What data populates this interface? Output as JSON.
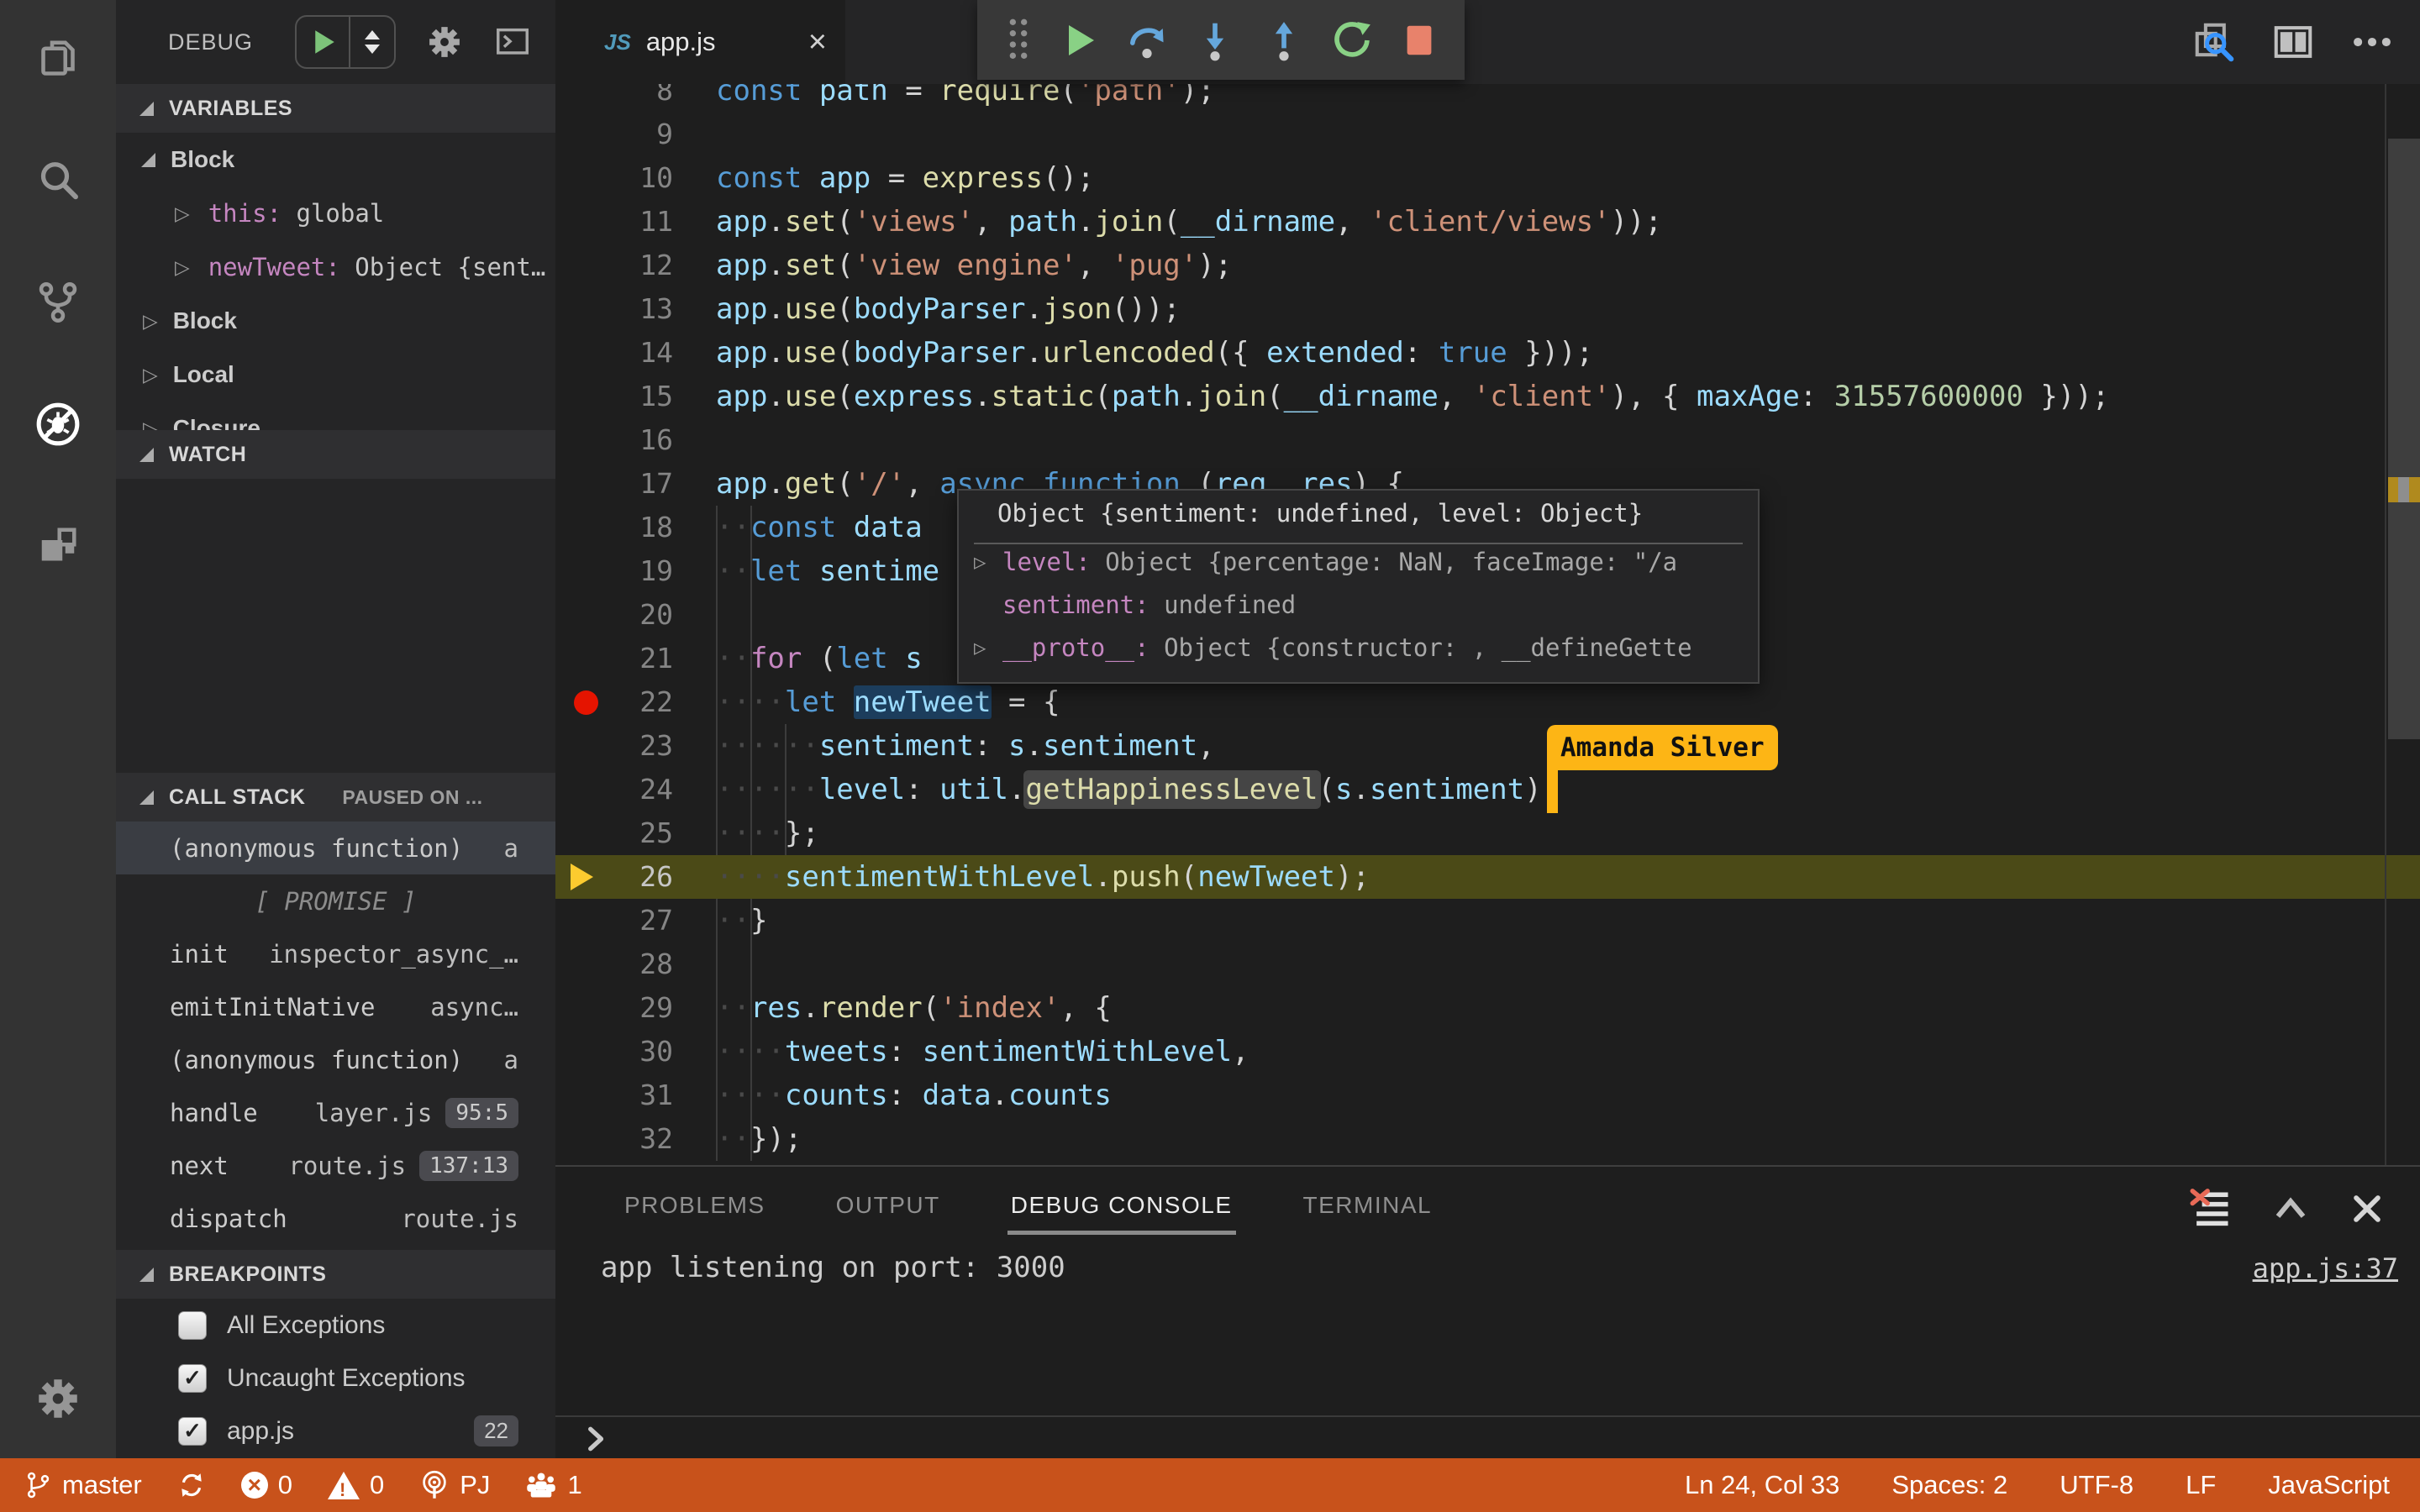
{
  "colors": {
    "status_bar": "#C8521B",
    "amanda_tag": "#FDB515",
    "breakpoint_red": "#E51400",
    "current_line_arrow": "#FCCB2F",
    "current_line_bg": "#4B4A17",
    "tab_js_icon": "#519ABA",
    "accent_blue": "#569CD6"
  },
  "activity_bar": {
    "items": [
      {
        "icon": "files-icon",
        "active": false
      },
      {
        "icon": "search-icon",
        "active": false
      },
      {
        "icon": "source-control-icon",
        "active": false
      },
      {
        "icon": "debug-icon",
        "active": true
      },
      {
        "icon": "extensions-icon",
        "active": false
      }
    ],
    "settings_icon": "gear-icon"
  },
  "sidebar": {
    "header": {
      "title": "DEBUG",
      "controls": [
        "start-debug-button",
        "launch-config-selector",
        "configure-gear",
        "debug-console-toggle"
      ]
    },
    "variables": {
      "title": "VARIABLES",
      "rows": [
        {
          "type": "group",
          "label": "Block",
          "expanded": true
        },
        {
          "type": "item",
          "key": "this:",
          "value": " global"
        },
        {
          "type": "item",
          "key": "newTweet:",
          "value": " Object {sent…"
        },
        {
          "type": "group",
          "label": "Block",
          "expanded": false
        },
        {
          "type": "group",
          "label": "Local",
          "expanded": false
        },
        {
          "type": "group",
          "label": "Closure",
          "expanded": false
        }
      ]
    },
    "watch": {
      "title": "WATCH"
    },
    "call_stack": {
      "title": "CALL STACK",
      "status": "PAUSED ON ...",
      "frames": [
        {
          "name": "(anonymous function)",
          "file": "a",
          "selected": true
        },
        {
          "label": "[ PROMISE ]",
          "promise": true
        },
        {
          "name": "init",
          "file": "inspector_async_…"
        },
        {
          "name": "emitInitNative",
          "file": "async…"
        },
        {
          "name": "(anonymous function)",
          "file": "a"
        },
        {
          "name": "handle",
          "file": "layer.js",
          "badge": "95:5"
        },
        {
          "name": "next",
          "file": "route.js",
          "badge": "137:13"
        },
        {
          "name": "dispatch",
          "file": "route.js"
        }
      ]
    },
    "breakpoints": {
      "title": "BREAKPOINTS",
      "rows": [
        {
          "label": "All Exceptions",
          "checked": false
        },
        {
          "label": "Uncaught Exceptions",
          "checked": true
        },
        {
          "label": "app.js",
          "checked": true,
          "badge": "22"
        }
      ]
    }
  },
  "editor": {
    "tab": {
      "icon_label": "JS",
      "title": "app.js",
      "close": "×"
    },
    "toolbar": {
      "icons": [
        "drag-grip",
        "continue",
        "step-over",
        "step-into",
        "step-out",
        "restart",
        "stop"
      ]
    },
    "actions": [
      "find-references-icon",
      "split-editor-icon",
      "more-actions-icon"
    ],
    "lines": [
      {
        "n": 8,
        "t": [
          [
            "k",
            "const "
          ],
          [
            "v",
            "path"
          ],
          [
            "p",
            " = "
          ],
          [
            "f",
            "require"
          ],
          [
            "p",
            "("
          ],
          [
            "s",
            "'path'"
          ],
          [
            "p",
            ");"
          ]
        ]
      },
      {
        "n": 9,
        "t": []
      },
      {
        "n": 10,
        "t": [
          [
            "k",
            "const "
          ],
          [
            "v",
            "app"
          ],
          [
            "p",
            " = "
          ],
          [
            "f",
            "express"
          ],
          [
            "p",
            "();"
          ]
        ]
      },
      {
        "n": 11,
        "t": [
          [
            "v",
            "app"
          ],
          [
            "p",
            "."
          ],
          [
            "f",
            "set"
          ],
          [
            "p",
            "("
          ],
          [
            "s",
            "'views'"
          ],
          [
            "p",
            ", "
          ],
          [
            "v",
            "path"
          ],
          [
            "p",
            "."
          ],
          [
            "f",
            "join"
          ],
          [
            "p",
            "("
          ],
          [
            "v",
            "__dirname"
          ],
          [
            "p",
            ", "
          ],
          [
            "s",
            "'client/views'"
          ],
          [
            "p",
            "));"
          ]
        ]
      },
      {
        "n": 12,
        "t": [
          [
            "v",
            "app"
          ],
          [
            "p",
            "."
          ],
          [
            "f",
            "set"
          ],
          [
            "p",
            "("
          ],
          [
            "s",
            "'view engine'"
          ],
          [
            "p",
            ", "
          ],
          [
            "s",
            "'pug'"
          ],
          [
            "p",
            ");"
          ]
        ]
      },
      {
        "n": 13,
        "t": [
          [
            "v",
            "app"
          ],
          [
            "p",
            "."
          ],
          [
            "f",
            "use"
          ],
          [
            "p",
            "("
          ],
          [
            "v",
            "bodyParser"
          ],
          [
            "p",
            "."
          ],
          [
            "f",
            "json"
          ],
          [
            "p",
            "());"
          ]
        ]
      },
      {
        "n": 14,
        "t": [
          [
            "v",
            "app"
          ],
          [
            "p",
            "."
          ],
          [
            "f",
            "use"
          ],
          [
            "p",
            "("
          ],
          [
            "v",
            "bodyParser"
          ],
          [
            "p",
            "."
          ],
          [
            "f",
            "urlencoded"
          ],
          [
            "p",
            "({ "
          ],
          [
            "v",
            "extended"
          ],
          [
            "p",
            ": "
          ],
          [
            "k",
            "true"
          ],
          [
            "p",
            " }));"
          ]
        ]
      },
      {
        "n": 15,
        "t": [
          [
            "v",
            "app"
          ],
          [
            "p",
            "."
          ],
          [
            "f",
            "use"
          ],
          [
            "p",
            "("
          ],
          [
            "v",
            "express"
          ],
          [
            "p",
            "."
          ],
          [
            "f",
            "static"
          ],
          [
            "p",
            "("
          ],
          [
            "v",
            "path"
          ],
          [
            "p",
            "."
          ],
          [
            "f",
            "join"
          ],
          [
            "p",
            "("
          ],
          [
            "v",
            "__dirname"
          ],
          [
            "p",
            ", "
          ],
          [
            "s",
            "'client'"
          ],
          [
            "p",
            "), { "
          ],
          [
            "v",
            "maxAge"
          ],
          [
            "p",
            ": "
          ],
          [
            "n",
            "31557600000"
          ],
          [
            "p",
            " }));"
          ]
        ]
      },
      {
        "n": 16,
        "t": []
      },
      {
        "n": 17,
        "t": [
          [
            "v",
            "app"
          ],
          [
            "p",
            "."
          ],
          [
            "f",
            "get"
          ],
          [
            "p",
            "("
          ],
          [
            "s",
            "'/'"
          ],
          [
            "p",
            ", "
          ],
          [
            "k",
            "async"
          ],
          [
            "p",
            " "
          ],
          [
            "k",
            "function"
          ],
          [
            "p",
            " ("
          ],
          [
            "v",
            "req"
          ],
          [
            "p",
            ", "
          ],
          [
            "v",
            "res"
          ],
          [
            "p",
            ") {"
          ]
        ]
      },
      {
        "n": 18,
        "t": [
          [
            "w",
            "··"
          ],
          [
            "k",
            "const "
          ],
          [
            "v",
            "data"
          ]
        ]
      },
      {
        "n": 19,
        "t": [
          [
            "w",
            "··"
          ],
          [
            "k",
            "let "
          ],
          [
            "v",
            "sentime"
          ]
        ]
      },
      {
        "n": 20,
        "t": []
      },
      {
        "n": 21,
        "t": [
          [
            "w",
            "··"
          ],
          [
            "c",
            "for"
          ],
          [
            "p",
            " ("
          ],
          [
            "k",
            "let "
          ],
          [
            "v",
            "s"
          ]
        ]
      },
      {
        "n": 22,
        "bp": true,
        "t": [
          [
            "w",
            "····"
          ],
          [
            "k",
            "let "
          ],
          [
            "v",
            "newTweet",
            "sel"
          ],
          [
            "p",
            " = {"
          ]
        ]
      },
      {
        "n": 23,
        "t": [
          [
            "w",
            "······"
          ],
          [
            "v",
            "sentiment"
          ],
          [
            "p",
            ": "
          ],
          [
            "v",
            "s"
          ],
          [
            "p",
            "."
          ],
          [
            "v",
            "sentiment"
          ],
          [
            "p",
            ","
          ]
        ]
      },
      {
        "n": 24,
        "t": [
          [
            "w",
            "······"
          ],
          [
            "v",
            "level"
          ],
          [
            "p",
            ": "
          ],
          [
            "v",
            "util"
          ],
          [
            "p",
            "."
          ],
          [
            "f",
            "getHappinessLevel",
            "hl"
          ],
          [
            "p",
            "("
          ],
          [
            "v",
            "s"
          ],
          [
            "p",
            "."
          ],
          [
            "v",
            "sentiment"
          ],
          [
            "p",
            ")"
          ]
        ]
      },
      {
        "n": 25,
        "t": [
          [
            "w",
            "····"
          ],
          [
            "p",
            "};"
          ]
        ]
      },
      {
        "n": 26,
        "cur": true,
        "t": [
          [
            "w",
            "····"
          ],
          [
            "v",
            "sentimentWithLevel"
          ],
          [
            "p",
            "."
          ],
          [
            "f",
            "push"
          ],
          [
            "p",
            "("
          ],
          [
            "v",
            "newTweet"
          ],
          [
            "p",
            ");"
          ]
        ]
      },
      {
        "n": 27,
        "t": [
          [
            "w",
            "··"
          ],
          [
            "p",
            "}"
          ]
        ]
      },
      {
        "n": 28,
        "t": []
      },
      {
        "n": 29,
        "t": [
          [
            "w",
            "··"
          ],
          [
            "v",
            "res"
          ],
          [
            "p",
            "."
          ],
          [
            "f",
            "render"
          ],
          [
            "p",
            "("
          ],
          [
            "s",
            "'index'"
          ],
          [
            "p",
            ", {"
          ]
        ]
      },
      {
        "n": 30,
        "t": [
          [
            "w",
            "····"
          ],
          [
            "v",
            "tweets"
          ],
          [
            "p",
            ": "
          ],
          [
            "v",
            "sentimentWithLevel"
          ],
          [
            "p",
            ","
          ]
        ]
      },
      {
        "n": 31,
        "t": [
          [
            "w",
            "····"
          ],
          [
            "v",
            "counts"
          ],
          [
            "p",
            ": "
          ],
          [
            "v",
            "data"
          ],
          [
            "p",
            "."
          ],
          [
            "v",
            "counts"
          ]
        ]
      },
      {
        "n": 32,
        "t": [
          [
            "w",
            "··"
          ],
          [
            "p",
            "});"
          ]
        ]
      }
    ],
    "popup": {
      "title": "Object {sentiment: undefined, level: Object}",
      "rows": [
        {
          "arrow": true,
          "key": "level:",
          "value": " Object {percentage: NaN, faceImage: \"/a"
        },
        {
          "arrow": false,
          "key": "sentiment:",
          "value": " undefined"
        },
        {
          "arrow": true,
          "key": "__proto__:",
          "value": " Object {constructor: , __defineGette"
        }
      ]
    },
    "amanda": {
      "label": "Amanda Silver"
    }
  },
  "panel": {
    "tabs": [
      "PROBLEMS",
      "OUTPUT",
      "DEBUG CONSOLE",
      "TERMINAL"
    ],
    "active_tab": "DEBUG CONSOLE",
    "actions": [
      "clear-console-icon",
      "maximize-panel-icon",
      "close-panel-icon"
    ],
    "console_line": "app listening on port: 3000",
    "link": "app.js:37"
  },
  "status_bar": {
    "left": [
      {
        "icon": "git-branch-icon",
        "label": "master"
      },
      {
        "icon": "sync-icon",
        "label": ""
      },
      {
        "icon": "error-circle-icon",
        "label": "0"
      },
      {
        "icon": "warning-triangle-icon",
        "label": "0"
      },
      {
        "icon": "broadcast-icon",
        "label": "PJ"
      },
      {
        "icon": "people-icon",
        "label": "1"
      }
    ],
    "right": [
      "Ln 24, Col 33",
      "Spaces: 2",
      "UTF-8",
      "LF",
      "JavaScript"
    ]
  }
}
